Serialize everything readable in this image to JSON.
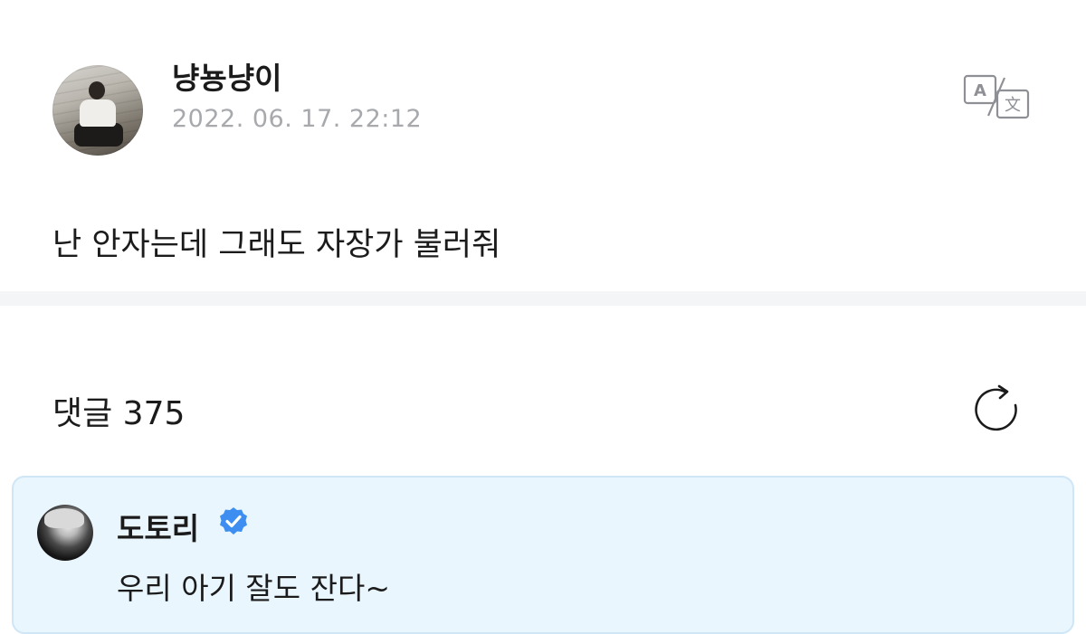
{
  "post": {
    "author_name": "냥뇽냥이",
    "timestamp": "2022. 06. 17. 22:12",
    "body": "난 안자는데 그래도 자장가 불러줘",
    "translate_icon": "translate-icon"
  },
  "comments": {
    "header": "댓글 375",
    "refresh_icon": "refresh-icon",
    "items": [
      {
        "author_name": "도토리",
        "verified": true,
        "text": "우리 아기 잘도 잔다~"
      }
    ]
  },
  "colors": {
    "timestamp": "#a7a9ad",
    "comment_bg": "#eaf6fe",
    "comment_border": "#cfe6f6",
    "verified_badge": "#3d8ef0",
    "divider": "#f4f5f7"
  }
}
